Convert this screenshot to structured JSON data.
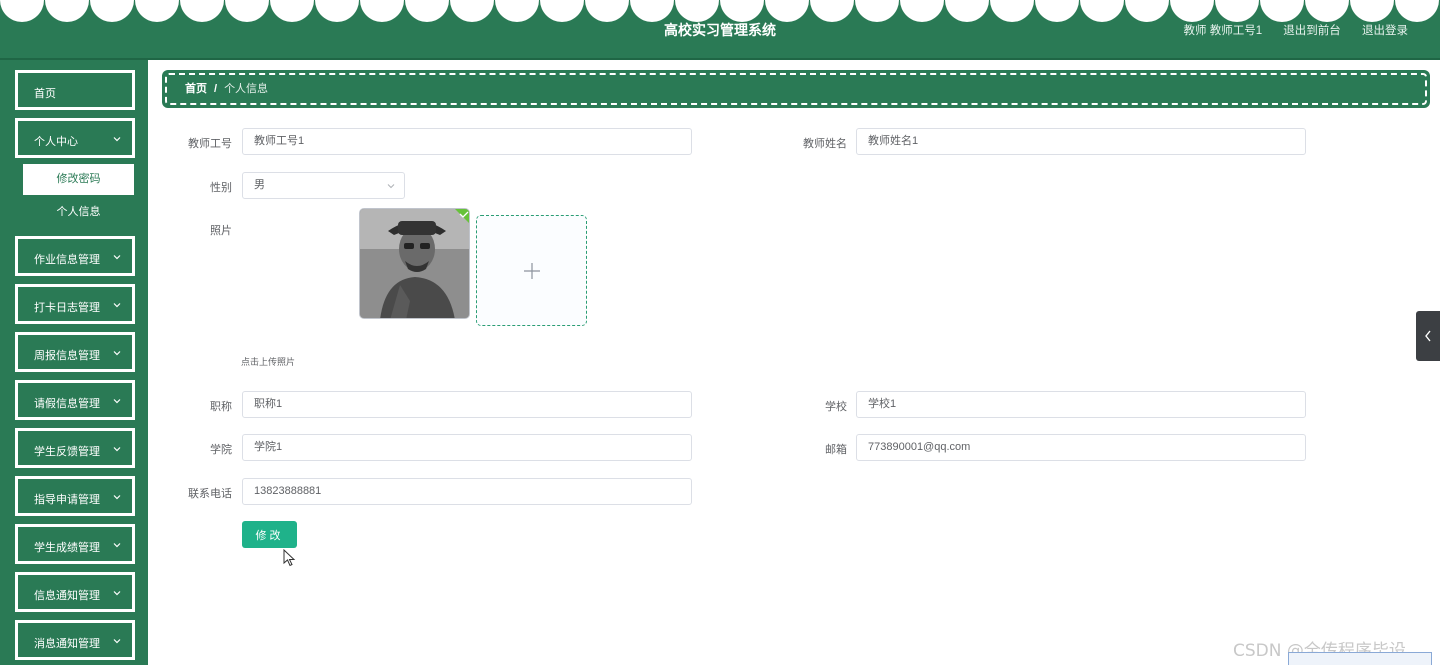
{
  "header": {
    "title": "高校实习管理系统",
    "user_label": "教师  教师工号1",
    "front_link": "退出到前台",
    "logout_link": "退出登录"
  },
  "sidebar": {
    "items": [
      {
        "label": "首页"
      },
      {
        "label": "个人中心"
      },
      {
        "label": "修改密码"
      },
      {
        "label": "个人信息"
      },
      {
        "label": "作业信息管理"
      },
      {
        "label": "打卡日志管理"
      },
      {
        "label": "周报信息管理"
      },
      {
        "label": "请假信息管理"
      },
      {
        "label": "学生反馈管理"
      },
      {
        "label": "指导申请管理"
      },
      {
        "label": "学生成绩管理"
      },
      {
        "label": "信息通知管理"
      },
      {
        "label": "消息通知管理"
      }
    ]
  },
  "breadcrumb": {
    "home": "首页",
    "separator": "/",
    "current": "个人信息"
  },
  "form": {
    "teacher_id": {
      "label": "教师工号",
      "value": "教师工号1"
    },
    "teacher_name": {
      "label": "教师姓名",
      "value": "教师姓名1"
    },
    "gender": {
      "label": "性别",
      "value": "男"
    },
    "photo": {
      "label": "照片",
      "tip": "点击上传照片"
    },
    "title": {
      "label": "职称",
      "value": "职称1"
    },
    "school": {
      "label": "学校",
      "value": "学校1"
    },
    "college": {
      "label": "学院",
      "value": "学院1"
    },
    "email": {
      "label": "邮箱",
      "value": "773890001@qq.com"
    },
    "phone": {
      "label": "联系电话",
      "value": "13823888881"
    },
    "submit_label": "修改"
  },
  "watermark": "CSDN @全传程序毕设",
  "colors": {
    "primary_green": "#2a7a55",
    "button_green": "#1fb28a",
    "upload_border": "#2a9d74"
  }
}
